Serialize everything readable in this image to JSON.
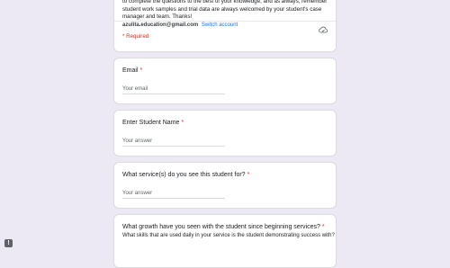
{
  "intro": {
    "text": "to complete the questions to the best of your knowledge, and as always, remember student work samples and trial data are always welcomed by your student's case manager and team. Thanks!"
  },
  "account": {
    "email": "azulita.education@gmail.com",
    "switch_label": "Switch account",
    "icon": "cloud-save-icon"
  },
  "required_note": "* Required",
  "questions": [
    {
      "title": "Email",
      "required_mark": "*",
      "placeholder": "Your email"
    },
    {
      "title": "Enter Student Name",
      "required_mark": "*",
      "placeholder": "Your answer"
    },
    {
      "title": "What service(s) do you see this student for?",
      "required_mark": "*",
      "placeholder": "Your answer"
    },
    {
      "title": "What growth have you seen with the student since beginning services?",
      "required_mark": "*",
      "description": "What skills that are used daily in your service is the student demonstrating success with?"
    }
  ],
  "report_icon": "report-issue-icon"
}
